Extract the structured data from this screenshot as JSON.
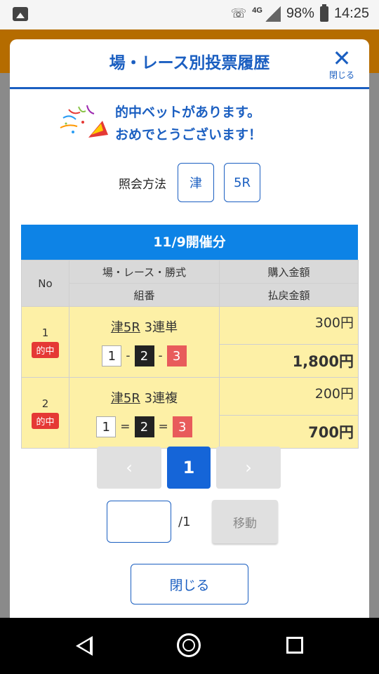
{
  "status_bar": {
    "network": "4G",
    "battery": "98%",
    "time": "14:25"
  },
  "modal": {
    "title": "場・レース別投票履歴",
    "close_label": "閉じる",
    "congrats_line1": "的中ベットがあります。",
    "congrats_line2": "おめでとうございます！",
    "query_label": "照会方法",
    "query_venue": "津",
    "query_race": "5R"
  },
  "table": {
    "caption": "11/9開催分",
    "headers": {
      "no": "No",
      "venue_race_type": "場・レース・勝式",
      "combination": "組番",
      "purchase": "購入金額",
      "payout": "払戻金額"
    },
    "rows": [
      {
        "no": "1",
        "hit": "的中",
        "venue_race": "津5R",
        "bet_type": "3連単",
        "c1": "1",
        "sep1": "-",
        "c2": "2",
        "sep2": "-",
        "c3": "3",
        "purchase": "300円",
        "payout": "1,800円"
      },
      {
        "no": "2",
        "hit": "的中",
        "venue_race": "津5R",
        "bet_type": "3連複",
        "c1": "1",
        "sep1": "=",
        "c2": "2",
        "sep2": "=",
        "c3": "3",
        "purchase": "200円",
        "payout": "700円"
      }
    ]
  },
  "pagination": {
    "prev": "‹",
    "current": "1",
    "next": "›",
    "total": "/1",
    "move_label": "移動",
    "page_input": ""
  },
  "footer": {
    "close_label": "閉じる"
  },
  "colors": {
    "accent": "#1b5fc1",
    "table_header": "#0d83e6",
    "hit_badge": "#e53935",
    "row_bg": "#fdf0a6"
  }
}
